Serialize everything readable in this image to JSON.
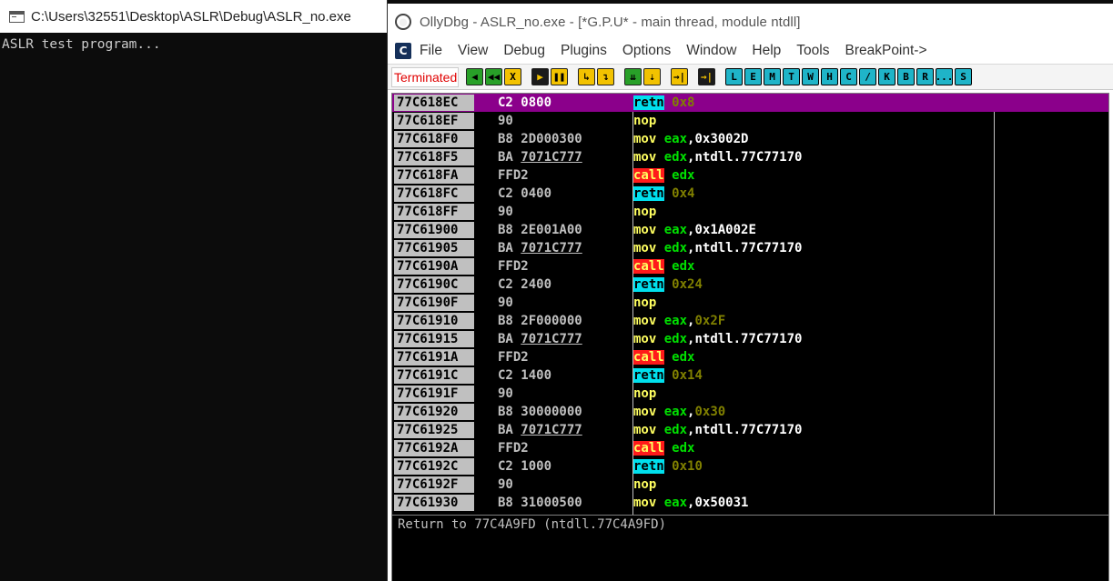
{
  "console": {
    "title": "C:\\Users\\32551\\Desktop\\ASLR\\Debug\\ASLR_no.exe",
    "output": "ASLR test program..."
  },
  "olly": {
    "title": "OllyDbg - ASLR_no.exe - [*G.P.U* - main thread, module ntdll]",
    "menu": [
      "File",
      "View",
      "Debug",
      "Plugins",
      "Options",
      "Window",
      "Help",
      "Tools",
      "BreakPoint->"
    ],
    "status": "Terminated",
    "toolbar_run": [
      "◀",
      "◀◀",
      "X"
    ],
    "toolbar_play": [
      "▶",
      "❚❚"
    ],
    "toolbar_step": [
      "↳",
      "↴",
      "⇊",
      "⇣",
      "→|"
    ],
    "toolbar_goto": [
      "→|"
    ],
    "toolbar_windows": [
      "L",
      "E",
      "M",
      "T",
      "W",
      "H",
      "C",
      "/",
      "K",
      "B",
      "R",
      "...",
      "S"
    ],
    "disasm": [
      {
        "addr": "77C618EC",
        "hex": "C2 0800",
        "hex_ul": "",
        "op": "retn",
        "kind": "retn",
        "args": [
          {
            "t": "0x8",
            "c": "num"
          }
        ],
        "selected": true
      },
      {
        "addr": "77C618EF",
        "hex": "90",
        "hex_ul": "",
        "op": "nop",
        "kind": "plain",
        "args": []
      },
      {
        "addr": "77C618F0",
        "hex": "B8 2D000300",
        "hex_ul": "",
        "op": "mov",
        "kind": "plain",
        "args": [
          {
            "t": "eax",
            "c": "reg"
          },
          {
            "t": ",",
            "c": "punc"
          },
          {
            "t": "0x3002D",
            "c": "imm"
          }
        ]
      },
      {
        "addr": "77C618F5",
        "hex": "BA ",
        "hex_ul": "7071C777",
        "op": "mov",
        "kind": "plain",
        "args": [
          {
            "t": "edx",
            "c": "reg"
          },
          {
            "t": ",",
            "c": "punc"
          },
          {
            "t": "ntdll.77C77170",
            "c": "lbl"
          }
        ]
      },
      {
        "addr": "77C618FA",
        "hex": "FFD2",
        "hex_ul": "",
        "op": "call",
        "kind": "call",
        "args": [
          {
            "t": "edx",
            "c": "reg"
          }
        ]
      },
      {
        "addr": "77C618FC",
        "hex": "C2 0400",
        "hex_ul": "",
        "op": "retn",
        "kind": "retn",
        "args": [
          {
            "t": "0x4",
            "c": "num"
          }
        ]
      },
      {
        "addr": "77C618FF",
        "hex": "90",
        "hex_ul": "",
        "op": "nop",
        "kind": "plain",
        "args": []
      },
      {
        "addr": "77C61900",
        "hex": "B8 2E001A00",
        "hex_ul": "",
        "op": "mov",
        "kind": "plain",
        "args": [
          {
            "t": "eax",
            "c": "reg"
          },
          {
            "t": ",",
            "c": "punc"
          },
          {
            "t": "0x1A002E",
            "c": "imm"
          }
        ]
      },
      {
        "addr": "77C61905",
        "hex": "BA ",
        "hex_ul": "7071C777",
        "op": "mov",
        "kind": "plain",
        "args": [
          {
            "t": "edx",
            "c": "reg"
          },
          {
            "t": ",",
            "c": "punc"
          },
          {
            "t": "ntdll.77C77170",
            "c": "lbl"
          }
        ]
      },
      {
        "addr": "77C6190A",
        "hex": "FFD2",
        "hex_ul": "",
        "op": "call",
        "kind": "call",
        "args": [
          {
            "t": "edx",
            "c": "reg"
          }
        ]
      },
      {
        "addr": "77C6190C",
        "hex": "C2 2400",
        "hex_ul": "",
        "op": "retn",
        "kind": "retn",
        "args": [
          {
            "t": "0x24",
            "c": "num"
          }
        ]
      },
      {
        "addr": "77C6190F",
        "hex": "90",
        "hex_ul": "",
        "op": "nop",
        "kind": "plain",
        "args": []
      },
      {
        "addr": "77C61910",
        "hex": "B8 2F000000",
        "hex_ul": "",
        "op": "mov",
        "kind": "plain",
        "args": [
          {
            "t": "eax",
            "c": "reg"
          },
          {
            "t": ",",
            "c": "punc"
          },
          {
            "t": "0x2F",
            "c": "num"
          }
        ]
      },
      {
        "addr": "77C61915",
        "hex": "BA ",
        "hex_ul": "7071C777",
        "op": "mov",
        "kind": "plain",
        "args": [
          {
            "t": "edx",
            "c": "reg"
          },
          {
            "t": ",",
            "c": "punc"
          },
          {
            "t": "ntdll.77C77170",
            "c": "lbl"
          }
        ]
      },
      {
        "addr": "77C6191A",
        "hex": "FFD2",
        "hex_ul": "",
        "op": "call",
        "kind": "call",
        "args": [
          {
            "t": "edx",
            "c": "reg"
          }
        ]
      },
      {
        "addr": "77C6191C",
        "hex": "C2 1400",
        "hex_ul": "",
        "op": "retn",
        "kind": "retn",
        "args": [
          {
            "t": "0x14",
            "c": "num"
          }
        ]
      },
      {
        "addr": "77C6191F",
        "hex": "90",
        "hex_ul": "",
        "op": "nop",
        "kind": "plain",
        "args": []
      },
      {
        "addr": "77C61920",
        "hex": "B8 30000000",
        "hex_ul": "",
        "op": "mov",
        "kind": "plain",
        "args": [
          {
            "t": "eax",
            "c": "reg"
          },
          {
            "t": ",",
            "c": "punc"
          },
          {
            "t": "0x30",
            "c": "num"
          }
        ]
      },
      {
        "addr": "77C61925",
        "hex": "BA ",
        "hex_ul": "7071C777",
        "op": "mov",
        "kind": "plain",
        "args": [
          {
            "t": "edx",
            "c": "reg"
          },
          {
            "t": ",",
            "c": "punc"
          },
          {
            "t": "ntdll.77C77170",
            "c": "lbl"
          }
        ]
      },
      {
        "addr": "77C6192A",
        "hex": "FFD2",
        "hex_ul": "",
        "op": "call",
        "kind": "call",
        "args": [
          {
            "t": "edx",
            "c": "reg"
          }
        ]
      },
      {
        "addr": "77C6192C",
        "hex": "C2 1000",
        "hex_ul": "",
        "op": "retn",
        "kind": "retn",
        "args": [
          {
            "t": "0x10",
            "c": "num"
          }
        ]
      },
      {
        "addr": "77C6192F",
        "hex": "90",
        "hex_ul": "",
        "op": "nop",
        "kind": "plain",
        "args": []
      },
      {
        "addr": "77C61930",
        "hex": "B8 31000500",
        "hex_ul": "",
        "op": "mov",
        "kind": "plain",
        "args": [
          {
            "t": "eax",
            "c": "reg"
          },
          {
            "t": ",",
            "c": "punc"
          },
          {
            "t": "0x50031",
            "c": "imm"
          }
        ]
      }
    ],
    "info": "Return to 77C4A9FD (ntdll.77C4A9FD)"
  }
}
